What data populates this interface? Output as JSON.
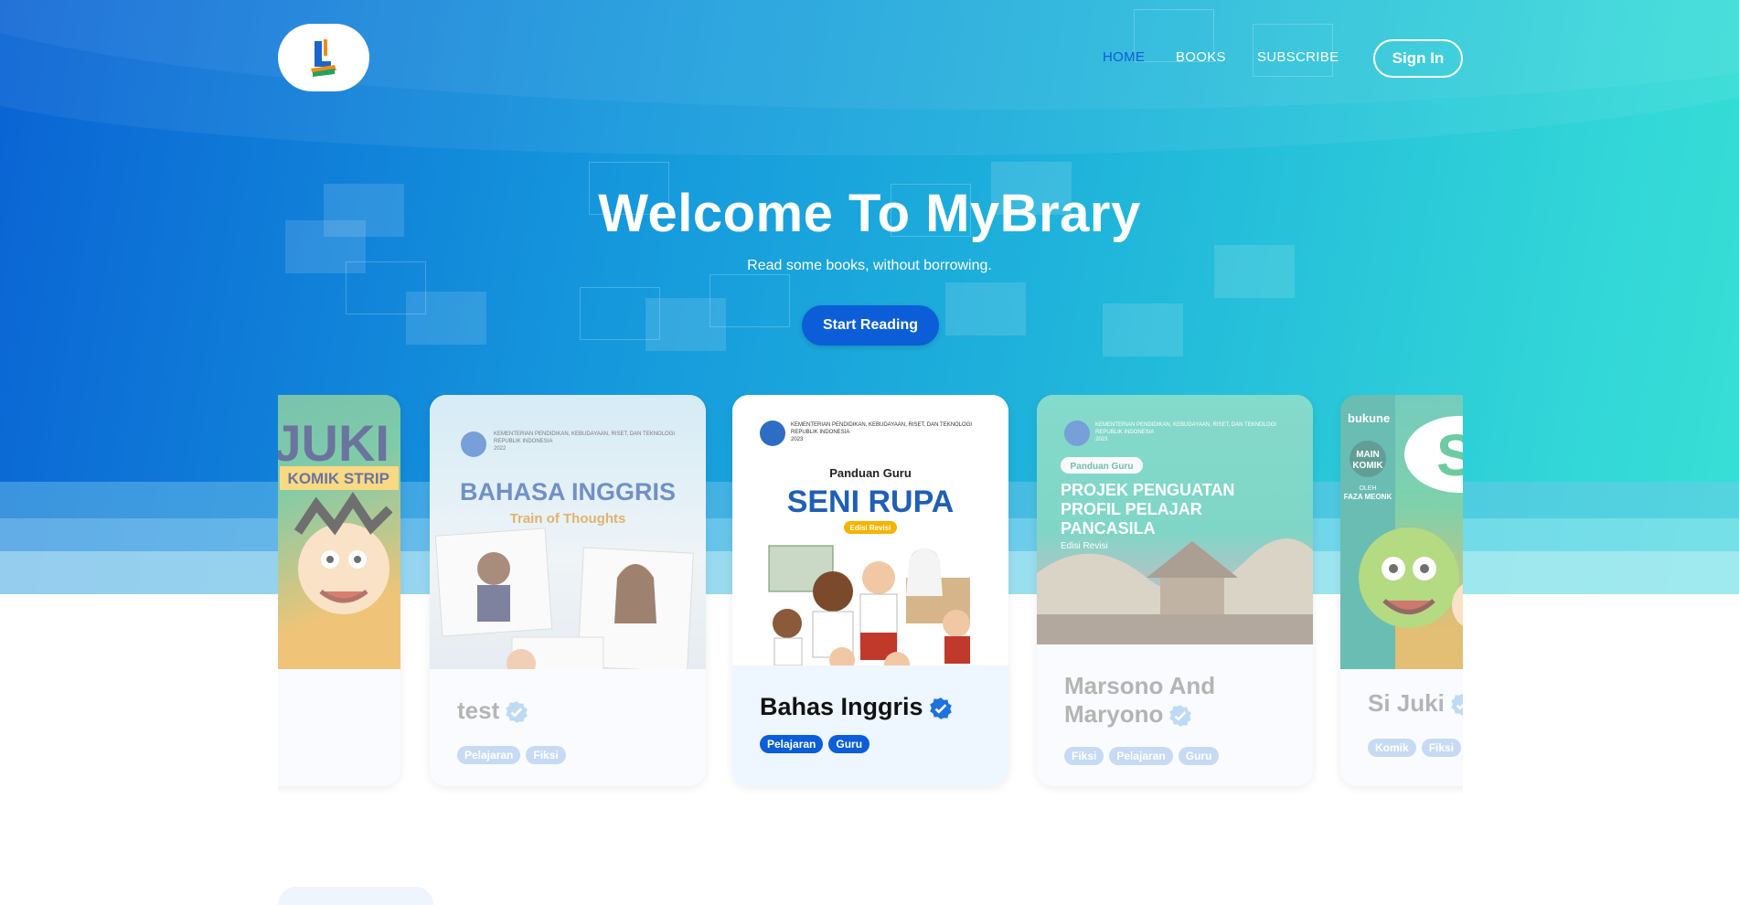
{
  "brand": {
    "logo_icon": "book-logo-icon"
  },
  "nav": {
    "items": [
      {
        "label": "HOME",
        "active": true
      },
      {
        "label": "BOOKS",
        "active": false
      },
      {
        "label": "SUBSCRIBE",
        "active": false
      }
    ],
    "signin_label": "Sign In"
  },
  "hero": {
    "title": "Welcome To MyBrary",
    "subtitle": "Read some books, without borrowing.",
    "cta_label": "Start Reading"
  },
  "books": [
    {
      "title": "",
      "cover_text": [
        "JUKI",
        "KOMIK STRIP"
      ],
      "tags": []
    },
    {
      "title": "test",
      "cover_text": [
        "KEMENTERIAN PENDIDIKAN, KEBUDAYAAN, RISET, DAN TEKNOLOGI",
        "REPUBLIK INDONESIA",
        "2022",
        "BAHASA INGGRIS",
        "Train of Thoughts"
      ],
      "tags": [
        "Pelajaran",
        "Fiksi"
      ]
    },
    {
      "title": "Bahas Inggris",
      "cover_text": [
        "KEMENTERIAN PENDIDIKAN, KEBUDAYAAN, RISET, DAN TEKNOLOGI",
        "REPUBLIK INDONESIA",
        "2023",
        "Panduan Guru",
        "SENI RUPA",
        "Edisi Revisi"
      ],
      "tags": [
        "Pelajaran",
        "Guru"
      ]
    },
    {
      "title": "Marsono And Maryono",
      "cover_text": [
        "KEMENTERIAN PENDIDIKAN, KEBUDAYAAN, RISET, DAN TEKNOLOGI",
        "REPUBLIK INDONESIA",
        "2023",
        "Panduan Guru",
        "PROJEK PENGUATAN",
        "PROFIL PELAJAR",
        "PANCASILA",
        "Edisi Revisi"
      ],
      "tags": [
        "Fiksi",
        "Pelajaran",
        "Guru"
      ]
    },
    {
      "title": "Si Juki",
      "cover_text": [
        "bukune",
        "MAIN",
        "KOMIK",
        "OLEH",
        "FAZA MEONK"
      ],
      "tags": [
        "Komik",
        "Fiksi"
      ]
    }
  ],
  "colors": {
    "accent": "#0b5ed7",
    "hero_start": "#0a63d4",
    "hero_end": "#37e0d5"
  }
}
